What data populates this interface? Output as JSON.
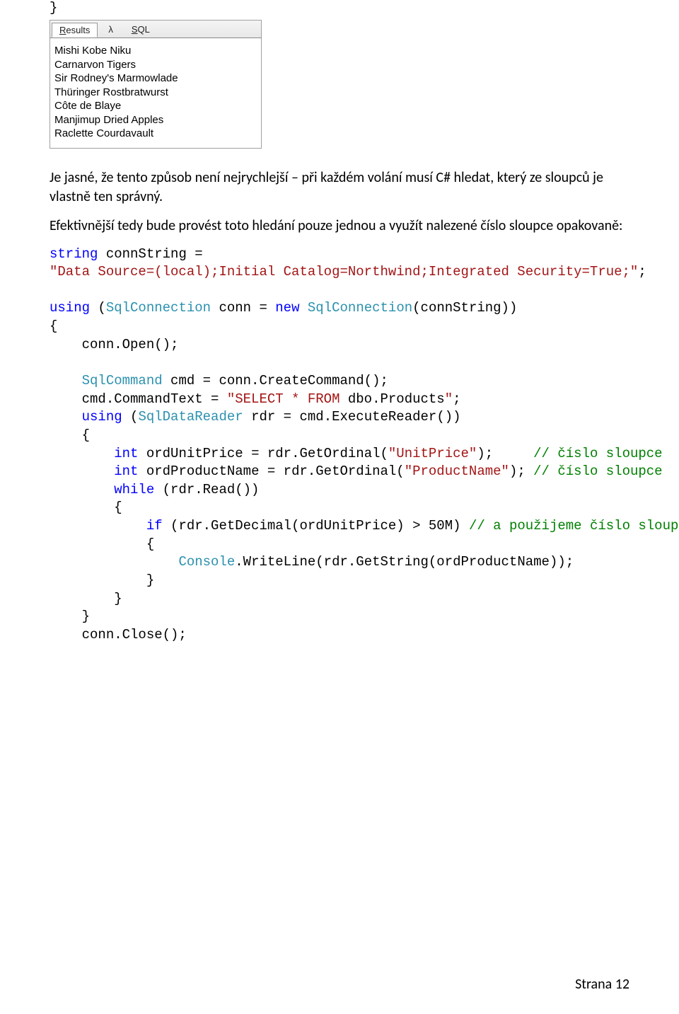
{
  "topBrace": "}",
  "tabs": {
    "results": "Results",
    "lambda": "λ",
    "sql": "SQL"
  },
  "resultLines": [
    "Mishi Kobe Niku",
    "Carnarvon Tigers",
    "Sir Rodney's Marmowlade",
    "Thüringer Rostbratwurst",
    "Côte de Blaye",
    "Manjimup Dried Apples",
    "Raclette Courdavault"
  ],
  "para1": "Je jasné, že tento způsob není nejrychlejší – při každém volání musí C# hledat, který ze sloupců je vlastně ten správný.",
  "para2": "Efektivnější tedy bude provést toto hledání pouze jednou a využít nalezené číslo sloupce opakovaně:",
  "code": {
    "connString": "\"Data Source=(local);Initial Catalog=Northwind;Integrated Security=True;\"",
    "cmdText1": "\"SELECT * FROM ",
    "cmdText2": "dbo.Products",
    "cmdText3": "\"",
    "unitPrice": "\"UnitPrice\"",
    "productName": "\"ProductName\"",
    "cmt1": "// číslo sloupce",
    "cmt2": "// číslo sloupce",
    "cmt3": "// a použijeme číslo sloupce",
    "fifty": "50M"
  },
  "footer": "Strana 12"
}
